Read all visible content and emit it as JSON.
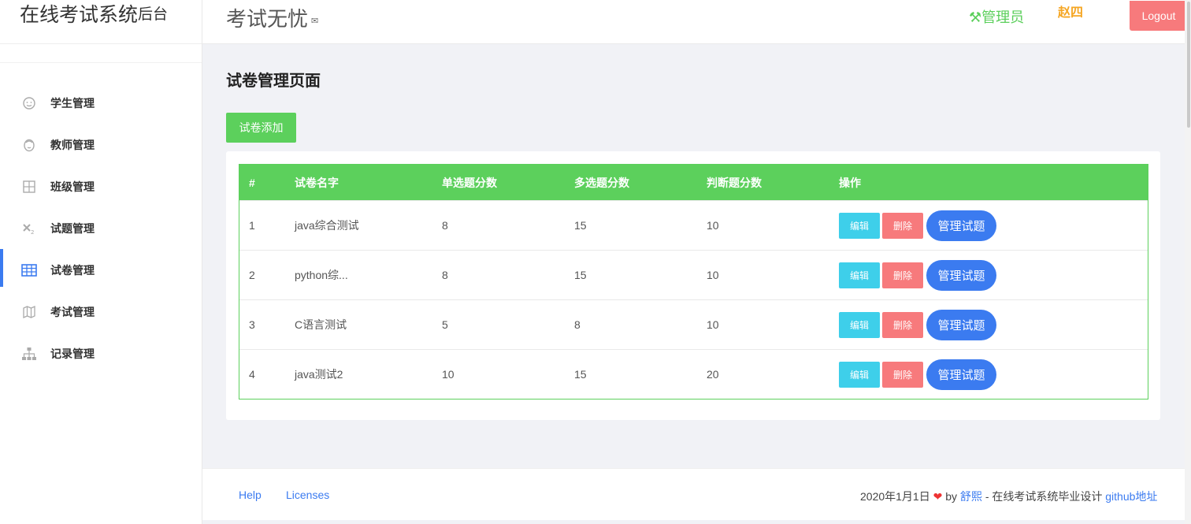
{
  "sidebar": {
    "brand_main": "在线考试系统",
    "brand_sub": "后台",
    "items": [
      {
        "label": "学生管理",
        "icon": "smile-icon"
      },
      {
        "label": "教师管理",
        "icon": "face-icon"
      },
      {
        "label": "班级管理",
        "icon": "grid-icon"
      },
      {
        "label": "试题管理",
        "icon": "subscript-icon"
      },
      {
        "label": "试卷管理",
        "icon": "table-icon",
        "active": true
      },
      {
        "label": "考试管理",
        "icon": "map-icon"
      },
      {
        "label": "记录管理",
        "icon": "sitemap-icon"
      }
    ]
  },
  "header": {
    "title": "考试无忧",
    "role": "管理员",
    "user": "赵四",
    "logout": "Logout"
  },
  "main": {
    "page_title": "试卷管理页面",
    "add_button": "试卷添加",
    "table": {
      "headers": [
        "#",
        "试卷名字",
        "单选题分数",
        "多选题分数",
        "判断题分数",
        "操作"
      ],
      "rows": [
        [
          "1",
          "java综合测试",
          "8",
          "15",
          "10"
        ],
        [
          "2",
          "python综...",
          "8",
          "15",
          "10"
        ],
        [
          "3",
          "C语言测试",
          "5",
          "8",
          "10"
        ],
        [
          "4",
          "java测试2",
          "10",
          "15",
          "20"
        ]
      ],
      "edit_label": "编辑",
      "delete_label": "删除",
      "manage_label": "管理试题"
    }
  },
  "footer": {
    "help": "Help",
    "licenses": "Licenses",
    "date": "2020年1月1日",
    "by": "by",
    "author": "舒熙",
    "desc": "- 在线考试系统毕业设计",
    "github": "github地址"
  },
  "colors": {
    "accent_green": "#5cd05c",
    "primary_blue": "#3b7bf0",
    "danger_red": "#f77a7c",
    "info_cyan": "#3ecfea",
    "user_orange": "#f5a623"
  }
}
